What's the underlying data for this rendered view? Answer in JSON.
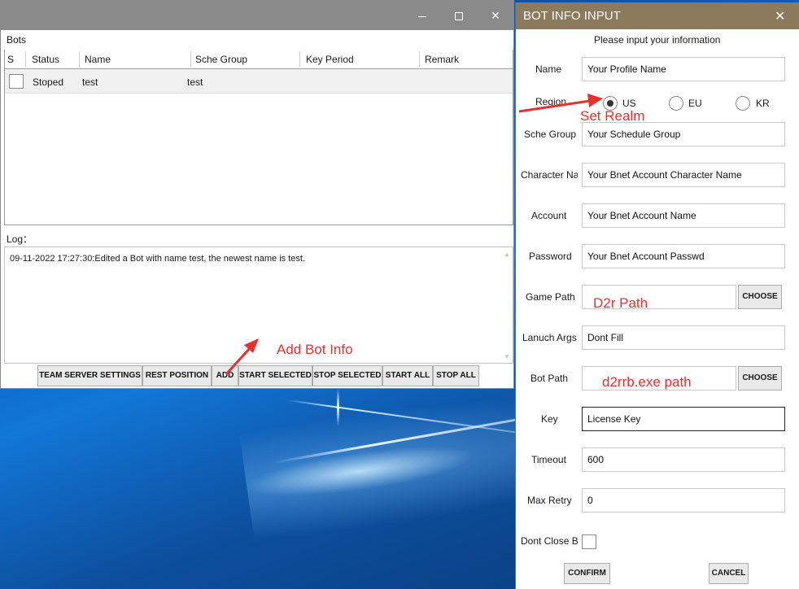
{
  "main_window": {
    "controls": {
      "minimize": "minimize",
      "maximize": "maximize",
      "close": "✕"
    },
    "bots_label": "Bots",
    "table": {
      "columns": [
        "S",
        "Status",
        "Name",
        "Sche Group",
        "Key Period",
        "Remark"
      ],
      "rows": [
        {
          "status": "Stoped",
          "name": "test",
          "sche_group": "test",
          "key_period": "",
          "remark": ""
        }
      ]
    },
    "log_label": "Log：",
    "log_lines": [
      "09-11-2022 17:27:30:Edited a Bot with name test, the newest name is test."
    ],
    "buttons": {
      "team_server_settings": "TEAM SERVER SETTINGS",
      "rest_position": "REST POSITION",
      "add": "ADD",
      "start_selected": "START SELECTED",
      "stop_selected": "STOP SELECTED",
      "start_all": "START ALL",
      "stop_all": "STOP ALL"
    }
  },
  "annotations": {
    "add_bot_info": "Add Bot Info",
    "set_realm": "Set Realm",
    "d2r_path": "D2r Path",
    "d2rrb_path": "d2rrb.exe path",
    "color": "#e8312f"
  },
  "dialog": {
    "title": "BOT INFO INPUT",
    "close": "✕",
    "subtitle": "Please input your information",
    "fields": {
      "name": {
        "label": "Name",
        "value": "Your Profile Name"
      },
      "region": {
        "label": "Region",
        "options": [
          "US",
          "EU",
          "KR"
        ],
        "selected": "US"
      },
      "sche_group": {
        "label": "Sche Group",
        "value": "Your Schedule Group"
      },
      "character_name": {
        "label": "Character Na",
        "value": "Your Bnet Account Character Name"
      },
      "account": {
        "label": "Account",
        "value": "Your Bnet Account Name"
      },
      "password": {
        "label": "Password",
        "value": "Your Bnet Account Passwd"
      },
      "game_path": {
        "label": "Game Path",
        "value": ""
      },
      "launch_args": {
        "label": "Lanuch Args",
        "value": "Dont Fill"
      },
      "bot_path": {
        "label": "Bot Path",
        "value": ""
      },
      "key": {
        "label": "Key",
        "value": "License Key"
      },
      "timeout": {
        "label": "Timeout",
        "value": "600"
      },
      "max_retry": {
        "label": "Max Retry",
        "value": "0"
      },
      "dont_close": {
        "label": "Dont Close B",
        "checked": false
      }
    },
    "choose_label": "CHOOSE",
    "confirm_label": "CONFIRM",
    "cancel_label": "CANCEL"
  },
  "colors": {
    "dialog_title_bar": "#8b7a5b",
    "main_title_bar": "#8a8a8a",
    "desktop": "#0a5bb8"
  }
}
